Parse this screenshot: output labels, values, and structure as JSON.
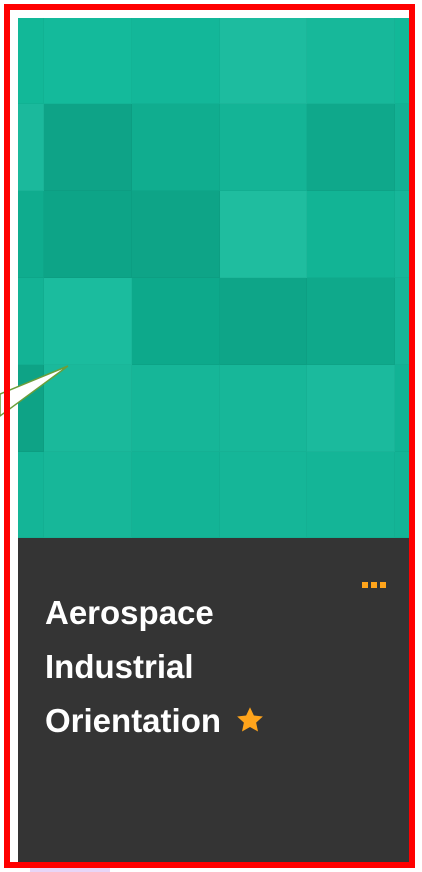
{
  "course_tile": {
    "title_lines": [
      "Aerospace",
      "Industrial",
      "Orientation"
    ],
    "banner_color": "#17b89a",
    "info_background": "#343434",
    "favorite": true,
    "favorite_icon": "star-icon",
    "favorite_color": "#ffa41b",
    "more_icon": "ellipsis-icon",
    "more_color": "#ffa41b"
  },
  "highlight": {
    "color": "#ff0000"
  }
}
